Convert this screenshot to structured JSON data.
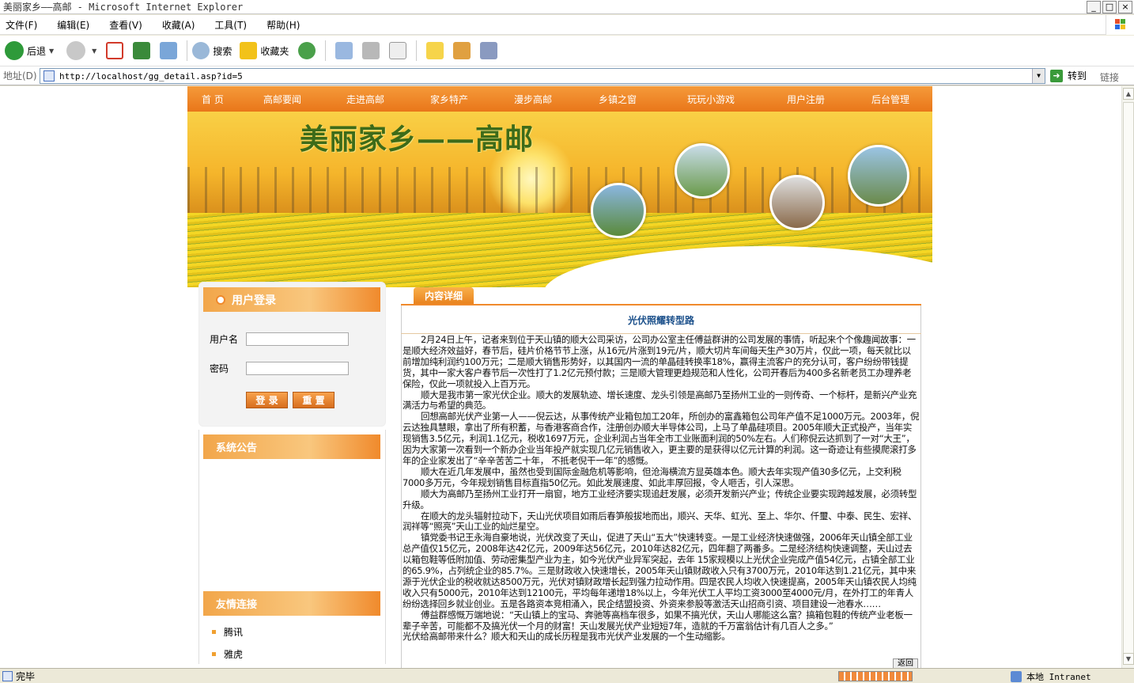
{
  "window": {
    "title": "美丽家乡——高邮 - Microsoft Internet Explorer",
    "btn_minimize": "_",
    "btn_maximize": "□",
    "btn_close": "×"
  },
  "menu": [
    "文件(F)",
    "编辑(E)",
    "查看(V)",
    "收藏(A)",
    "工具(T)",
    "帮助(H)"
  ],
  "toolbar": {
    "back": "后退",
    "search": "搜索",
    "favorites": "收藏夹"
  },
  "address": {
    "label": "地址(D)",
    "url": "http://localhost/gg_detail.asp?id=5",
    "go": "转到",
    "links": "链接"
  },
  "nav": [
    "首 页",
    "高邮要闻",
    "走进高邮",
    "家乡特产",
    "漫步高邮",
    "乡镇之窗",
    "玩玩小游戏",
    "用户注册",
    "后台管理"
  ],
  "banner_title": "美丽家乡——高邮",
  "login": {
    "heading": "用户登录",
    "username_label": "用户名",
    "password_label": "密码",
    "login_btn": "登 录",
    "reset_btn": "重 置"
  },
  "notice_heading": "系统公告",
  "links_heading": "友情连接",
  "links": [
    "腾讯",
    "雅虎"
  ],
  "content": {
    "tab": "内容详细",
    "title": "光伏照耀转型路",
    "paragraphs": [
      "2月24日上午，记者来到位于天山镇的顺大公司采访，公司办公室主任傅益群讲的公司发展的事情，听起来个个像趣闻故事：一是顺大经济效益好，春节后，硅片价格节节上涨，从16元/片涨到19元/片，顺大切片车间每天生产30万片，仅此一项，每天就比以前增加纯利润约100万元；二是顺大销售形势好，以其国内一流的单晶硅转换率18%，赢得主流客户的充分认可，客户纷纷带钱提货，其中一家大客户春节后一次性打了1.2亿元预付款；三是顺大管理更趋规范和人性化，公司开春后为400多名新老员工办理养老保险，仅此一项就投入上百万元。",
      "顺大是我市第一家光伏企业。顺大的发展轨迹、增长速度、龙头引领是高邮乃至扬州工业的一则传奇、一个标杆，是新兴产业充满活力与希望的典范。",
      "回想高邮光伏产业第一人——倪云达，从事传统产业箱包加工20年，所创办的富鑫箱包公司年产值不足1000万元。2003年，倪云达独具慧眼，拿出了所有积蓄，与香港客商合作，注册创办顺大半导体公司，上马了单晶硅项目。2005年顺大正式投产，当年实现销售3.5亿元，利润1.1亿元，税收1697万元，企业利润占当年全市工业账面利润的50%左右。人们称倪云达抓到了一对“大王”，因为大家第一次看到一个新办企业当年投产就实现几亿元销售收入，更主要的是获得以亿元计算的利润。这一奇迹让有些摸爬滚打多年的企业家发出了“辛辛苦苦二十年， 不抵老倪干一年”的感慨。",
      "顺大在近几年发展中，虽然也受到国际金融危机等影响，但沧海横流方显英雄本色。顺大去年实现产值30多亿元，上交利税7000多万元，今年规划销售目标直指50亿元。如此发展速度、如此丰厚回报，令人咂舌，引人深思。",
      "顺大为高邮乃至扬州工业打开一扇窗，地方工业经济要实现追赶发展，必须开发新兴产业；传统企业要实现跨越发展，必须转型升级。",
      "在顺大的龙头辐射拉动下，天山光伏项目如雨后春笋般拔地而出，顺兴、天华、虹光、至上、华尔、仟璽、中泰、民生、宏祥、润祥等“照亮”天山工业的灿烂星空。",
      "镇党委书记王永海自豪地说，光伏改变了天山，促进了天山“五大”快速转变。一是工业经济快速做强，2006年天山镇全部工业总产值仅15亿元，2008年达42亿元，2009年达56亿元，2010年达82亿元，四年翻了两番多。二是经济结构快速调整，天山过去以箱包鞋等低附加值、劳动密集型产业为主，如今光伏产业异军突起，去年 15家规模以上光伏企业完成产值54亿元，占镇全部工业的65.9%，占列统企业的85.7%。三是财政收入快速增长，2005年天山镇财政收入只有3700万元，2010年达到1.21亿元，其中来源于光伏企业的税收就达8500万元，光伏对镇财政增长起到强力拉动作用。四是农民人均收入快速提高，2005年天山镇农民人均纯收入只有5000元，2010年达到12100元，平均每年递增18%以上，今年光伏工人平均工资3000至4000元/月，在外打工的年青人纷纷选择回乡就业创业。五是各路资本竞相涌入，民企结盟投资、外资来参股等激活天山招商引资、项目建设一池春水……",
      "傅益群感慨万端地说：“天山镇上的宝马、奔驰等高档车很多，如果不搞光伏，天山人哪能这么富？搞箱包鞋的传统产业老板一辈子辛苦，可能都不及搞光伏一个月的财富！天山发展光伏产业短短7年，造就的千万富翁估计有几百人之多。”",
      "光伏给高邮带来什么？顺大和天山的成长历程是我市光伏产业发展的一个生动缩影。"
    ],
    "return_btn": "返回"
  },
  "status": {
    "text": "完毕",
    "zone": "本地 Intranet",
    "progress": 1.0
  }
}
